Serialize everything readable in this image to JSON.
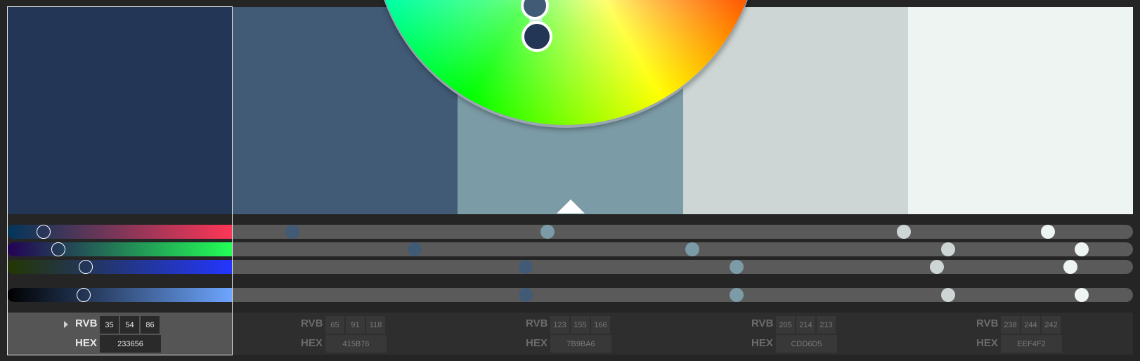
{
  "swatches": [
    {
      "hex": "233656",
      "rgb": [
        35,
        54,
        86
      ],
      "bg": "#233656",
      "dot_r": 0.14,
      "dot_g": 0.21,
      "dot_b": 0.34,
      "dot_l": 0.33
    },
    {
      "hex": "415B76",
      "rgb": [
        65,
        91,
        118
      ],
      "bg": "#415B76",
      "dot_r": 0.25,
      "dot_g": 0.36,
      "dot_b": 0.46,
      "dot_l": 0.46
    },
    {
      "hex": "7B9BA6",
      "rgb": [
        123,
        155,
        166
      ],
      "bg": "#7B9BA6",
      "dot_r": 0.48,
      "dot_g": 0.61,
      "dot_b": 0.65,
      "dot_l": 0.65
    },
    {
      "hex": "CDD6D5",
      "rgb": [
        205,
        214,
        213
      ],
      "bg": "#CDD6D5",
      "dot_r": 0.8,
      "dot_g": 0.84,
      "dot_b": 0.83,
      "dot_l": 0.84
    },
    {
      "hex": "EEF4F2",
      "rgb": [
        238,
        244,
        242
      ],
      "bg": "#EEF4F2",
      "dot_r": 0.93,
      "dot_g": 0.96,
      "dot_b": 0.95,
      "dot_l": 0.96
    }
  ],
  "labels": {
    "rgb": "RVB",
    "hex": "HEX"
  },
  "selected_index": 0
}
